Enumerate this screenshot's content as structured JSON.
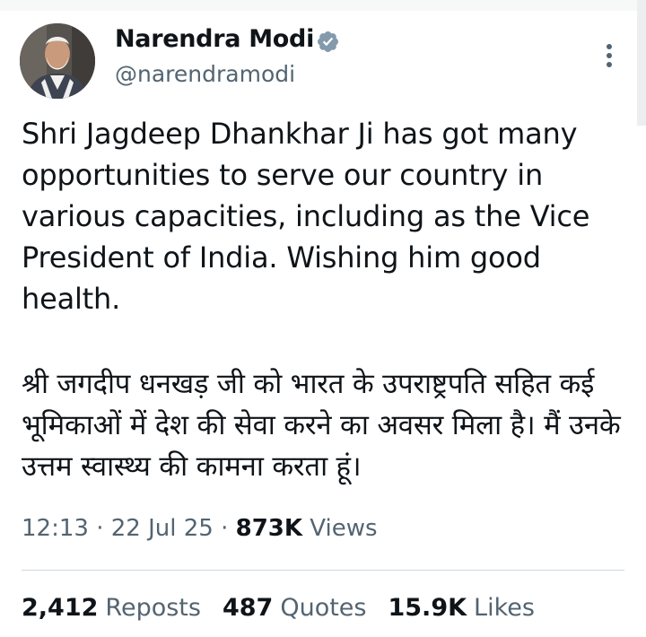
{
  "tweet": {
    "author": {
      "name": "Narendra Modi",
      "handle": "@narendramodi",
      "verified_color": "#829aab"
    },
    "text_en": "Shri Jagdeep Dhankhar Ji has got many opportunities to serve our country in various capacities, including as the Vice President of India. Wishing him good health.",
    "text_hi": "श्री जगदीप धनखड़ जी को भारत के उपराष्ट्रपति सहित कई भूमिकाओं में देश की सेवा करने का अवसर मिला है। मैं उनके उत्तम स्वास्थ्य की कामना करता हूं।",
    "meta": {
      "time": "12:13",
      "sep1": " · ",
      "date": "22 Jul 25",
      "sep2": " · ",
      "views_count": "873K",
      "views_label": " Views"
    },
    "stats": {
      "reposts_count": "2,412",
      "reposts_label": "Reposts",
      "quotes_count": "487",
      "quotes_label": "Quotes",
      "likes_count": "15.9K",
      "likes_label": "Likes"
    }
  },
  "icons": {
    "verified": "verified-badge-icon",
    "more": "more-vertical-icon"
  }
}
